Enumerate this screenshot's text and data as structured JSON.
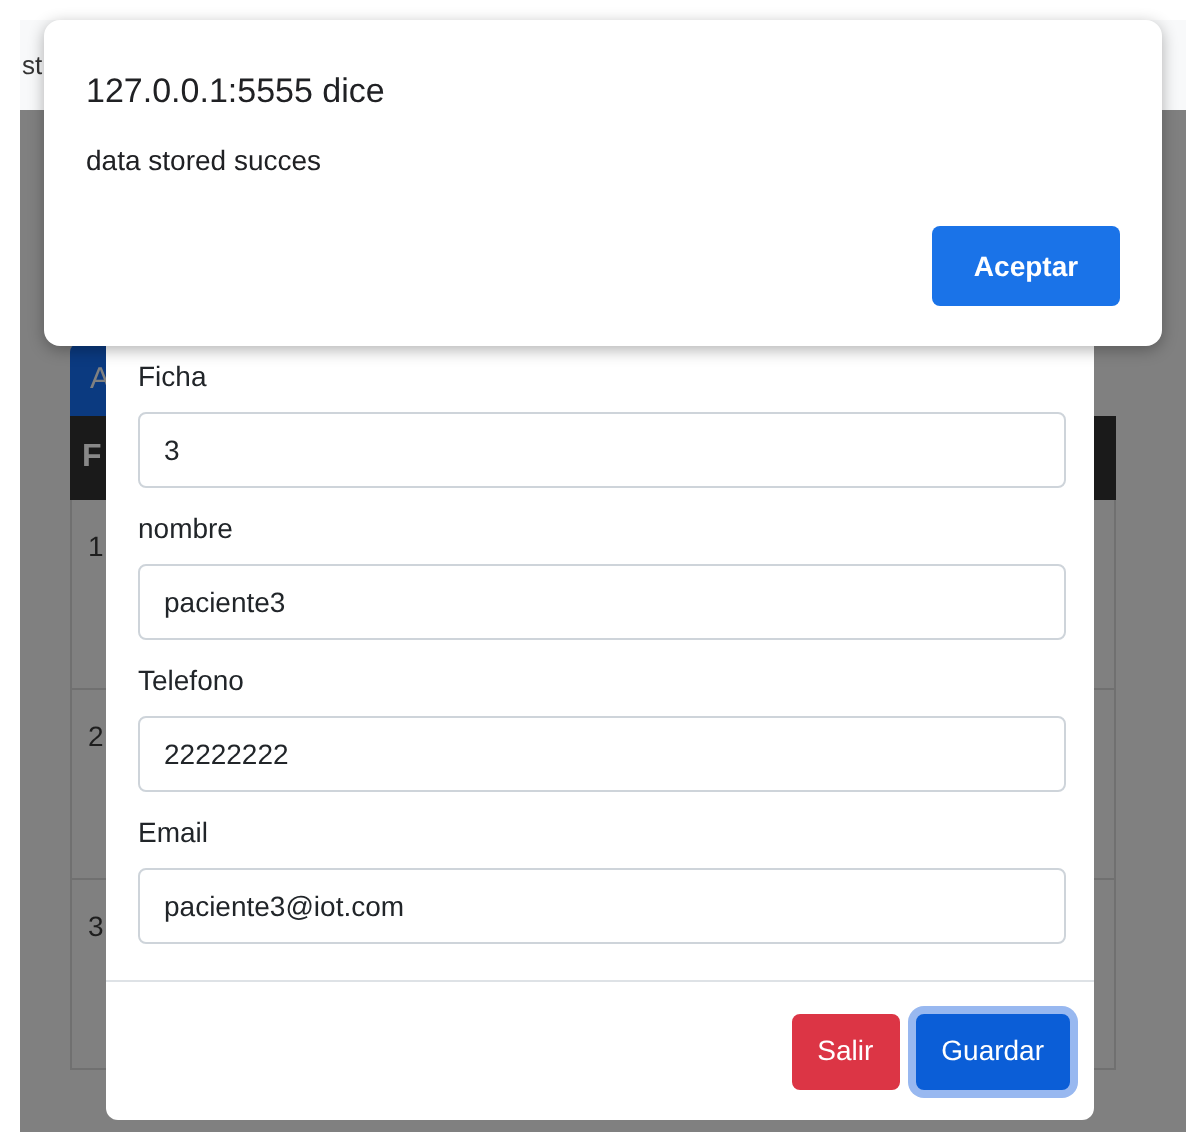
{
  "page": {
    "heading_fragment": "st",
    "button_fragment": "A",
    "table": {
      "header_fragment": "F",
      "rows": [
        "1",
        "2",
        "3"
      ]
    }
  },
  "modal": {
    "fields": [
      {
        "label": "Ficha",
        "value": "3"
      },
      {
        "label": "nombre",
        "value": "paciente3"
      },
      {
        "label": "Telefono",
        "value": "22222222"
      },
      {
        "label": "Email",
        "value": "paciente3@iot.com"
      }
    ],
    "buttons": [
      {
        "label": "Salir",
        "kind": "danger",
        "focused": false
      },
      {
        "label": "Guardar",
        "kind": "primary",
        "focused": true
      }
    ]
  },
  "alert": {
    "title": "127.0.0.1:5555 dice",
    "message": "data stored succes",
    "button": "Aceptar"
  }
}
